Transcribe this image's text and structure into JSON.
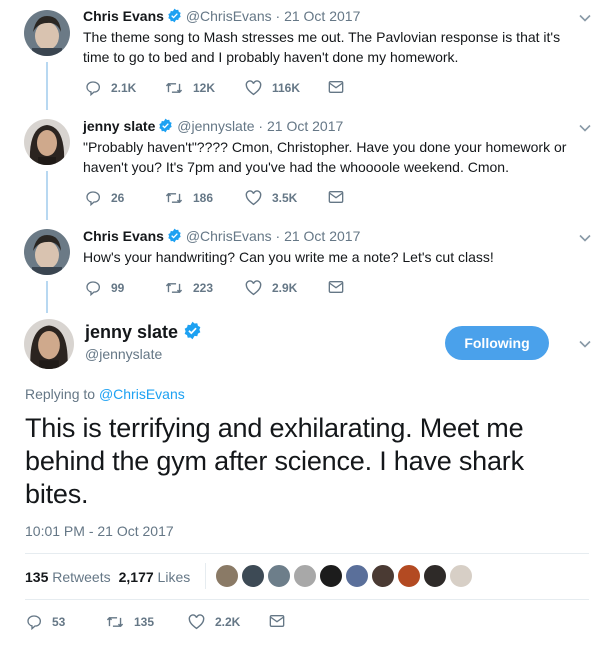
{
  "tweets": [
    {
      "name": "Chris Evans",
      "handle": "@ChrisEvans",
      "dot": "·",
      "date": "21 Oct 2017",
      "text": "The theme song to Mash stresses me out. The Pavlovian response is that it's time to go to bed and I probably haven't done my homework.",
      "replies": "2.1K",
      "retweets": "12K",
      "likes": "116K"
    },
    {
      "name": "jenny slate",
      "handle": "@jennyslate",
      "dot": "·",
      "date": "21 Oct 2017",
      "text": "\"Probably haven't\"???? Cmon, Christopher. Have you done your homework or haven't you? It's 7pm and you've had the whoooole weekend. Cmon.",
      "replies": "26",
      "retweets": "186",
      "likes": "3.5K"
    },
    {
      "name": "Chris Evans",
      "handle": "@ChrisEvans",
      "dot": "·",
      "date": "21 Oct 2017",
      "text": "How's your handwriting? Can you write me a note? Let's cut class!",
      "replies": "99",
      "retweets": "223",
      "likes": "2.9K"
    }
  ],
  "main": {
    "name": "jenny slate",
    "handle": "@jennyslate",
    "follow_label": "Following",
    "replying_prefix": "Replying to",
    "replying_to": "@ChrisEvans",
    "text": "This is terrifying and exhilarating. Meet me behind the gym after science. I have shark bites.",
    "timestamp": "10:01 PM - 21 Oct 2017",
    "retweet_count": "135",
    "retweet_label": "Retweets",
    "like_count": "2,177",
    "like_label": "Likes",
    "replies": "53",
    "retweets": "135",
    "likes": "2.2K"
  },
  "colors": {
    "accent": "#1da1f2",
    "follow_button": "#4aa1eb",
    "muted": "#657786",
    "thread_line": "#b8d8f1"
  },
  "icons": [
    "verified-badge-icon",
    "chevron-down-icon",
    "reply-icon",
    "retweet-icon",
    "like-heart-icon",
    "direct-message-icon"
  ]
}
